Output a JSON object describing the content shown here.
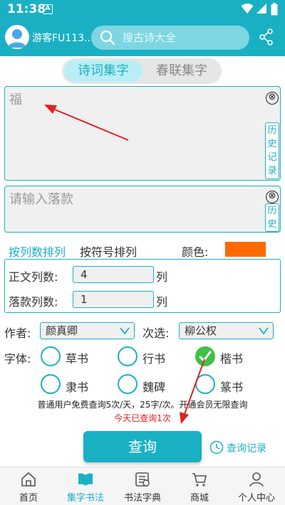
{
  "status_bar": {
    "time": "11:38",
    "app_badge": "A"
  },
  "header": {
    "username": "游客FU113...",
    "search_placeholder": "搜古诗大全"
  },
  "tabs": [
    {
      "label": "诗词集字",
      "active": true
    },
    {
      "label": "春联集字",
      "active": false
    }
  ],
  "main_text": {
    "value": "福",
    "clear_icon": "⊗",
    "history_label": "历史记录"
  },
  "signature": {
    "placeholder": "请输入落款",
    "clear_icon": "⊗",
    "history_label": "历史"
  },
  "sort": {
    "by_column": "按列数排列",
    "by_symbol": "按符号排列",
    "color_label": "颜色:",
    "color_value": "#ff6a00"
  },
  "columns": {
    "body_label": "正文列数:",
    "body_value": "4",
    "body_unit": "列",
    "sig_label": "落款列数:",
    "sig_value": "1",
    "sig_unit": "列"
  },
  "selectors": {
    "author_label": "作者:",
    "author_value": "颜真卿",
    "second_label": "次选:",
    "second_value": "柳公权"
  },
  "font_styles": {
    "label": "字体:",
    "options": [
      {
        "label": "草书",
        "checked": false
      },
      {
        "label": "行书",
        "checked": false
      },
      {
        "label": "楷书",
        "checked": true
      },
      {
        "label": "隶书",
        "checked": false
      },
      {
        "label": "魏碑",
        "checked": false
      },
      {
        "label": "篆书",
        "checked": false
      }
    ]
  },
  "notice": {
    "line1": "普通用户免费查询5次/天，25字/次。开通会员无限查询",
    "line2": "今天已查询1次"
  },
  "query_button": "查询",
  "history_link": "查询记录",
  "bottom_nav": [
    {
      "label": "首页",
      "icon": "home-icon",
      "active": false
    },
    {
      "label": "集字书法",
      "icon": "book-icon",
      "active": true
    },
    {
      "label": "书法字典",
      "icon": "dictionary-icon",
      "active": false
    },
    {
      "label": "商城",
      "icon": "cart-icon",
      "active": false
    },
    {
      "label": "个人中心",
      "icon": "person-icon",
      "active": false
    }
  ],
  "colors": {
    "primary": "#1ab0c4",
    "notice_red": "#e21b1b",
    "radio_checked": "#3fc04a"
  }
}
